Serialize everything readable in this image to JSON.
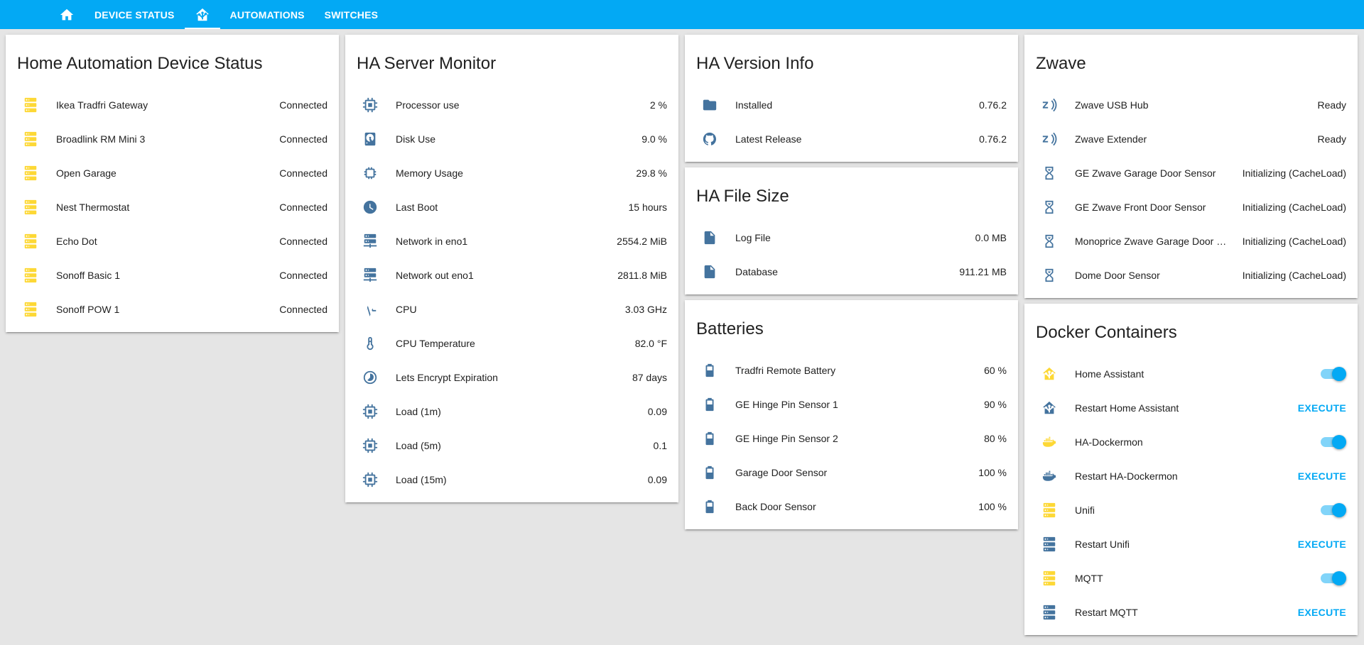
{
  "tabs": {
    "home_icon": "home-icon",
    "device_status": "DEVICE STATUS",
    "ha_icon": "home-assistant-icon",
    "automations": "AUTOMATIONS",
    "switches": "SWITCHES"
  },
  "colors": {
    "accent": "#03a9f4",
    "icon_blue": "#44739e",
    "icon_yellow": "#fdd835"
  },
  "device_status": {
    "title": "Home Automation Device Status",
    "rows": [
      {
        "icon": "server-icon",
        "name": "Ikea Tradfri Gateway",
        "value": "Connected"
      },
      {
        "icon": "server-icon",
        "name": "Broadlink RM Mini 3",
        "value": "Connected"
      },
      {
        "icon": "server-icon",
        "name": "Open Garage",
        "value": "Connected"
      },
      {
        "icon": "server-icon",
        "name": "Nest Thermostat",
        "value": "Connected"
      },
      {
        "icon": "server-icon",
        "name": "Echo Dot",
        "value": "Connected"
      },
      {
        "icon": "server-icon",
        "name": "Sonoff Basic 1",
        "value": "Connected"
      },
      {
        "icon": "server-icon",
        "name": "Sonoff POW 1",
        "value": "Connected"
      }
    ]
  },
  "server_monitor": {
    "title": "HA Server Monitor",
    "rows": [
      {
        "icon": "chip-icon",
        "name": "Processor use",
        "value": "2 %"
      },
      {
        "icon": "harddisk-icon",
        "name": "Disk Use",
        "value": "9.0 %"
      },
      {
        "icon": "memory-icon",
        "name": "Memory Usage",
        "value": "29.8 %"
      },
      {
        "icon": "clock-icon",
        "name": "Last Boot",
        "value": "15 hours"
      },
      {
        "icon": "server-network-icon",
        "name": "Network in eno1",
        "value": "2554.2 MiB"
      },
      {
        "icon": "server-network-icon",
        "name": "Network out eno1",
        "value": "2811.8 MiB"
      },
      {
        "icon": "pulse-icon",
        "name": "CPU",
        "value": "3.03 GHz"
      },
      {
        "icon": "thermometer-icon",
        "name": "CPU Temperature",
        "value": "82.0 °F"
      },
      {
        "icon": "timelapse-icon",
        "name": "Lets Encrypt Expiration",
        "value": "87 days"
      },
      {
        "icon": "chip-icon",
        "name": "Load (1m)",
        "value": "0.09"
      },
      {
        "icon": "chip-icon",
        "name": "Load (5m)",
        "value": "0.1"
      },
      {
        "icon": "chip-icon",
        "name": "Load (15m)",
        "value": "0.09"
      }
    ]
  },
  "version_info": {
    "title": "HA Version Info",
    "rows": [
      {
        "icon": "folder-download-icon",
        "name": "Installed",
        "value": "0.76.2"
      },
      {
        "icon": "github-icon",
        "name": "Latest Release",
        "value": "0.76.2"
      }
    ]
  },
  "file_size": {
    "title": "HA File Size",
    "rows": [
      {
        "icon": "file-icon",
        "name": "Log File",
        "value": "0.0 MB"
      },
      {
        "icon": "file-icon",
        "name": "Database",
        "value": "911.21 MB"
      }
    ]
  },
  "batteries": {
    "title": "Batteries",
    "rows": [
      {
        "icon": "battery-icon",
        "name": "Tradfri Remote Battery",
        "value": "60 %"
      },
      {
        "icon": "battery-icon",
        "name": "GE Hinge Pin Sensor 1",
        "value": "90 %"
      },
      {
        "icon": "battery-icon",
        "name": "GE Hinge Pin Sensor 2",
        "value": "80 %"
      },
      {
        "icon": "battery-icon",
        "name": "Garage Door Sensor",
        "value": "100 %"
      },
      {
        "icon": "battery-icon",
        "name": "Back Door Sensor",
        "value": "100 %"
      }
    ]
  },
  "zwave": {
    "title": "Zwave",
    "rows": [
      {
        "icon": "z-wave-icon",
        "name": "Zwave USB Hub",
        "value": "Ready"
      },
      {
        "icon": "z-wave-icon",
        "name": "Zwave Extender",
        "value": "Ready"
      },
      {
        "icon": "hourglass-icon",
        "name": "GE Zwave Garage Door Sensor",
        "value": "Initializing (CacheLoad)"
      },
      {
        "icon": "hourglass-icon",
        "name": "GE Zwave Front Door Sensor",
        "value": "Initializing (CacheLoad)"
      },
      {
        "icon": "hourglass-icon",
        "name": "Monoprice Zwave Garage Door S...",
        "value": "Initializing (CacheLoad)"
      },
      {
        "icon": "hourglass-icon",
        "name": "Dome Door Sensor",
        "value": "Initializing (CacheLoad)"
      }
    ]
  },
  "docker": {
    "title": "Docker Containers",
    "rows": [
      {
        "icon": "home-assistant-icon",
        "name": "Home Assistant",
        "control": "toggle",
        "on": true
      },
      {
        "icon": "home-assistant-icon",
        "name": "Restart Home Assistant",
        "control": "execute",
        "label": "EXECUTE"
      },
      {
        "icon": "docker-icon",
        "name": "HA-Dockermon",
        "control": "toggle",
        "on": true
      },
      {
        "icon": "docker-icon",
        "name": "Restart HA-Dockermon",
        "control": "execute",
        "label": "EXECUTE"
      },
      {
        "icon": "server-icon",
        "name": "Unifi",
        "control": "toggle",
        "on": true
      },
      {
        "icon": "server-icon",
        "name": "Restart Unifi",
        "control": "execute",
        "label": "EXECUTE"
      },
      {
        "icon": "server-icon",
        "name": "MQTT",
        "control": "toggle",
        "on": true
      },
      {
        "icon": "server-icon",
        "name": "Restart MQTT",
        "control": "execute",
        "label": "EXECUTE"
      }
    ]
  }
}
